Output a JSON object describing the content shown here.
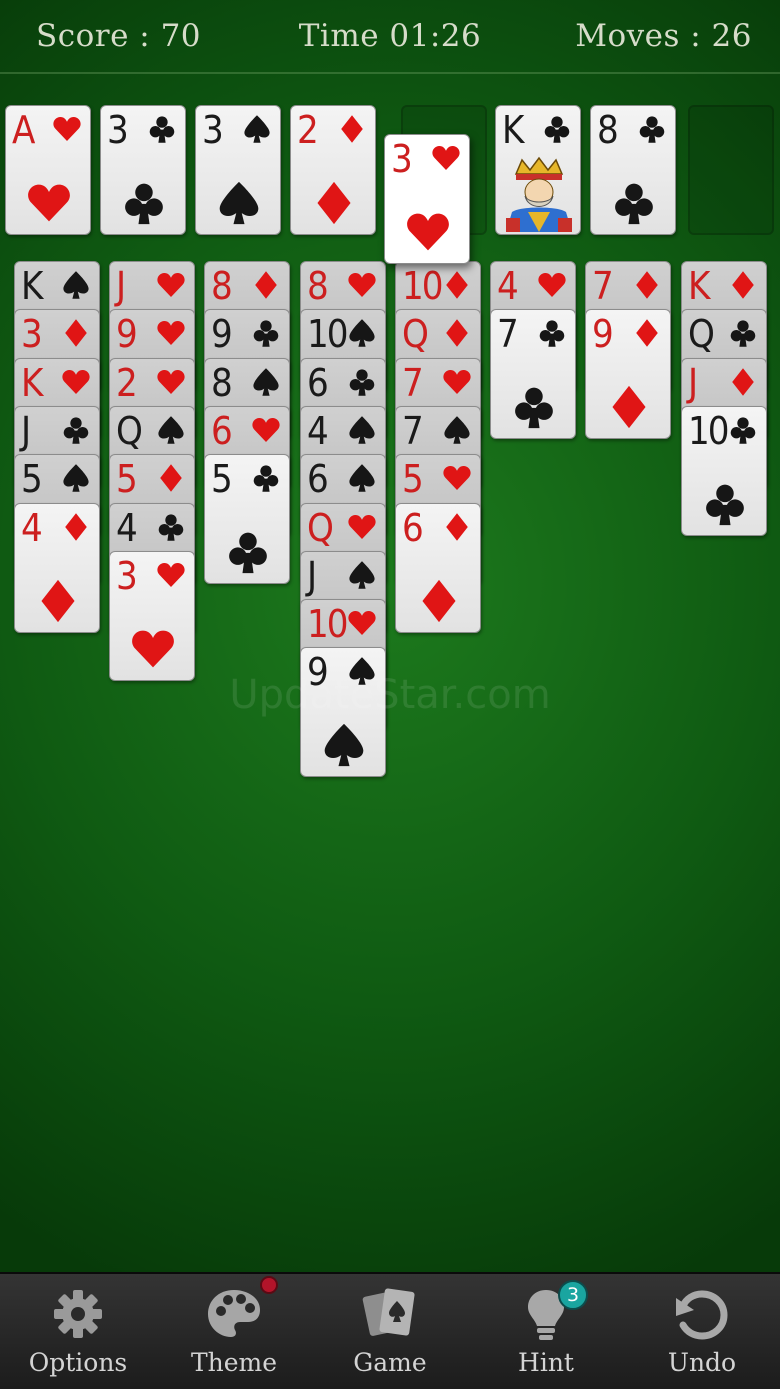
{
  "header": {
    "score": "Score : 70",
    "time": "Time 01:26",
    "moves": "Moves : 26"
  },
  "top_cards": [
    {
      "rank": "A",
      "suit": "hearts"
    },
    {
      "rank": "3",
      "suit": "clubs"
    },
    {
      "rank": "3",
      "suit": "spades"
    },
    {
      "rank": "2",
      "suit": "diamonds"
    },
    {
      "rank": "K",
      "suit": "clubs",
      "face": true
    },
    {
      "rank": "8",
      "suit": "clubs"
    }
  ],
  "held_card": {
    "rank": "3",
    "suit": "hearts"
  },
  "tableau": [
    [
      {
        "rank": "K",
        "suit": "spades"
      },
      {
        "rank": "3",
        "suit": "diamonds"
      },
      {
        "rank": "K",
        "suit": "hearts"
      },
      {
        "rank": "J",
        "suit": "clubs"
      },
      {
        "rank": "5",
        "suit": "spades"
      },
      {
        "rank": "4",
        "suit": "diamonds"
      }
    ],
    [
      {
        "rank": "J",
        "suit": "hearts"
      },
      {
        "rank": "9",
        "suit": "hearts"
      },
      {
        "rank": "2",
        "suit": "hearts"
      },
      {
        "rank": "Q",
        "suit": "spades"
      },
      {
        "rank": "5",
        "suit": "diamonds"
      },
      {
        "rank": "4",
        "suit": "clubs"
      },
      {
        "rank": "3",
        "suit": "hearts"
      }
    ],
    [
      {
        "rank": "8",
        "suit": "diamonds"
      },
      {
        "rank": "9",
        "suit": "clubs"
      },
      {
        "rank": "8",
        "suit": "spades"
      },
      {
        "rank": "6",
        "suit": "hearts"
      },
      {
        "rank": "5",
        "suit": "clubs"
      }
    ],
    [
      {
        "rank": "8",
        "suit": "hearts"
      },
      {
        "rank": "10",
        "suit": "spades"
      },
      {
        "rank": "6",
        "suit": "clubs"
      },
      {
        "rank": "4",
        "suit": "spades"
      },
      {
        "rank": "6",
        "suit": "spades"
      },
      {
        "rank": "Q",
        "suit": "hearts"
      },
      {
        "rank": "J",
        "suit": "spades"
      },
      {
        "rank": "10",
        "suit": "hearts"
      },
      {
        "rank": "9",
        "suit": "spades"
      }
    ],
    [
      {
        "rank": "10",
        "suit": "diamonds"
      },
      {
        "rank": "Q",
        "suit": "diamonds"
      },
      {
        "rank": "7",
        "suit": "hearts"
      },
      {
        "rank": "7",
        "suit": "spades"
      },
      {
        "rank": "5",
        "suit": "hearts"
      },
      {
        "rank": "6",
        "suit": "diamonds"
      }
    ],
    [
      {
        "rank": "4",
        "suit": "hearts"
      },
      {
        "rank": "7",
        "suit": "clubs"
      }
    ],
    [
      {
        "rank": "7",
        "suit": "diamonds"
      },
      {
        "rank": "9",
        "suit": "diamonds"
      }
    ],
    [
      {
        "rank": "K",
        "suit": "diamonds"
      },
      {
        "rank": "Q",
        "suit": "clubs"
      },
      {
        "rank": "J",
        "suit": "diamonds"
      },
      {
        "rank": "10",
        "suit": "clubs"
      }
    ]
  ],
  "watermark": "UpdateStar.com",
  "toolbar": {
    "options": "Options",
    "theme": "Theme",
    "game": "Game",
    "hint": "Hint",
    "undo": "Undo",
    "hint_count": "3"
  },
  "colors": {
    "felt": "#156b17",
    "red_suit": "#e01515",
    "black_suit": "#161616",
    "hint_badge": "#1aa5a0",
    "theme_badge": "#b3142a"
  },
  "icons": {
    "options": "gear-icon",
    "theme": "palette-icon",
    "game": "cards-icon",
    "hint": "lightbulb-icon",
    "undo": "undo-icon"
  }
}
